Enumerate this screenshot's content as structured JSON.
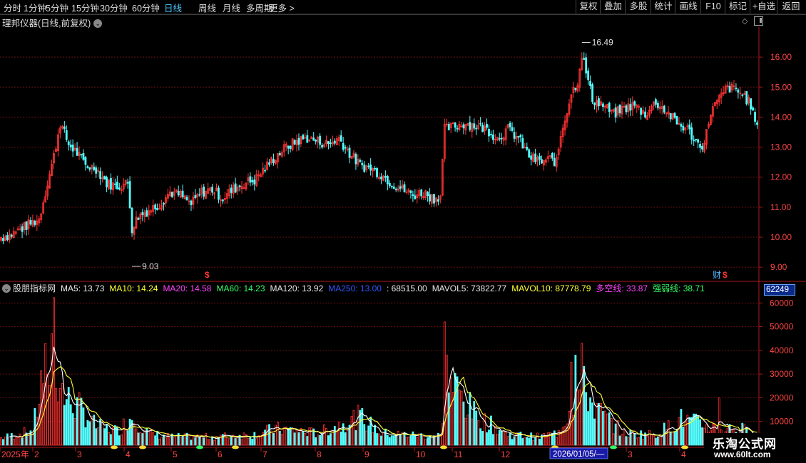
{
  "periods": [
    "分时",
    "1分钟",
    "5分钟",
    "15分钟",
    "30分钟",
    "60分钟",
    "日线",
    "周线",
    "月线",
    "多周期",
    "更多"
  ],
  "active_period": "日线",
  "toolbar": [
    "复权",
    "叠加",
    "多股",
    "统计",
    "画线",
    "F10",
    "标记",
    "+自选",
    "返回"
  ],
  "title": "理邦仪器(日线,前复权)",
  "indicator": {
    "name": "股朋指标网",
    "items": [
      {
        "label": "MA5: 13.73",
        "color": "#e8e8e8"
      },
      {
        "label": "MA10: 14.24",
        "color": "#ffff33"
      },
      {
        "label": "MA20: 14.58",
        "color": "#ff44ff"
      },
      {
        "label": "MA60: 14.23",
        "color": "#33ff66"
      },
      {
        "label": "MA120: 13.92",
        "color": "#e8e8e8"
      },
      {
        "label": "MA250: 13.00",
        "color": "#3355ff"
      },
      {
        "label": ": 68515.00",
        "color": "#e8e8e8"
      },
      {
        "label": "MAVOL5: 73822.77",
        "color": "#e8e8e8"
      },
      {
        "label": "MAVOL10: 87778.79",
        "color": "#ffff33"
      },
      {
        "label": "多空线: 33.87",
        "color": "#ff44ff"
      },
      {
        "label": "强弱线: 38.71",
        "color": "#33ff66"
      }
    ]
  },
  "current_volume": "62249",
  "price_max_label": "16.49",
  "price_min_label": "9.03",
  "fin_markers": {
    "dollar": "$",
    "fin": "财"
  },
  "x_cursor_label": "2026/01/05/—",
  "logo": {
    "title": "乐淘公式网",
    "url": "www.60lt.com"
  },
  "colors": {
    "up": "#ff3333",
    "down": "#54ffff",
    "grid": "#6a1010",
    "axis": "#b01818",
    "text": "#ff4444"
  },
  "chart_data": {
    "type": "candlestick",
    "price_axis": {
      "ticks": [
        9.0,
        10.0,
        11.0,
        12.0,
        13.0,
        14.0,
        15.0,
        16.0
      ],
      "labels": [
        "9.00",
        "10.00",
        "11.00",
        "12.00",
        "13.00",
        "14.00",
        "15.00",
        "16.00"
      ],
      "range": [
        8.6,
        17.0
      ]
    },
    "volume_axis": {
      "ticks": [
        10000,
        20000,
        30000,
        40000,
        50000,
        60000
      ],
      "labels": [
        "10000",
        "20000",
        "30000",
        "40000",
        "50000",
        "60000"
      ],
      "range": [
        0,
        64000
      ]
    },
    "x_labels": [
      "2025年",
      "2",
      "3",
      "4",
      "5",
      "6",
      "7",
      "8",
      "9",
      "10",
      "11",
      "12",
      "2026/01/05/—",
      "3",
      "4"
    ],
    "close_anchors": [
      [
        0,
        10.0
      ],
      [
        5,
        10.1
      ],
      [
        10,
        10.3
      ],
      [
        15,
        10.5
      ],
      [
        18,
        10.6
      ],
      [
        22,
        11.8
      ],
      [
        25,
        12.7
      ],
      [
        28,
        13.8
      ],
      [
        32,
        13.1
      ],
      [
        36,
        12.8
      ],
      [
        40,
        12.4
      ],
      [
        45,
        12.3
      ],
      [
        50,
        11.8
      ],
      [
        55,
        11.7
      ],
      [
        60,
        11.8
      ],
      [
        62,
        10.3
      ],
      [
        65,
        10.7
      ],
      [
        70,
        10.9
      ],
      [
        75,
        11.1
      ],
      [
        80,
        11.5
      ],
      [
        85,
        11.4
      ],
      [
        90,
        11.1
      ],
      [
        95,
        11.5
      ],
      [
        100,
        11.6
      ],
      [
        105,
        11.3
      ],
      [
        110,
        11.6
      ],
      [
        115,
        11.8
      ],
      [
        120,
        11.9
      ],
      [
        125,
        12.3
      ],
      [
        130,
        12.7
      ],
      [
        135,
        13.0
      ],
      [
        140,
        13.2
      ],
      [
        145,
        13.3
      ],
      [
        150,
        13.2
      ],
      [
        155,
        13.1
      ],
      [
        160,
        13.3
      ],
      [
        165,
        12.8
      ],
      [
        170,
        12.4
      ],
      [
        175,
        12.3
      ],
      [
        180,
        12.1
      ],
      [
        185,
        11.8
      ],
      [
        190,
        11.6
      ],
      [
        195,
        11.4
      ],
      [
        200,
        11.5
      ],
      [
        205,
        11.3
      ],
      [
        208,
        11.4
      ],
      [
        210,
        13.6
      ],
      [
        215,
        13.7
      ],
      [
        220,
        13.8
      ],
      [
        225,
        13.7
      ],
      [
        230,
        13.6
      ],
      [
        235,
        13.3
      ],
      [
        240,
        13.6
      ],
      [
        245,
        13.3
      ],
      [
        250,
        12.7
      ],
      [
        255,
        12.5
      ],
      [
        260,
        12.6
      ],
      [
        263,
        12.5
      ],
      [
        265,
        13.4
      ],
      [
        270,
        14.8
      ],
      [
        273,
        15.2
      ],
      [
        275,
        16.1
      ],
      [
        280,
        14.6
      ],
      [
        285,
        14.4
      ],
      [
        290,
        14.1
      ],
      [
        295,
        14.3
      ],
      [
        300,
        14.4
      ],
      [
        305,
        14.1
      ],
      [
        310,
        14.5
      ],
      [
        315,
        14.2
      ],
      [
        320,
        13.8
      ],
      [
        325,
        13.6
      ],
      [
        330,
        13.1
      ],
      [
        333,
        13.1
      ],
      [
        336,
        14.2
      ],
      [
        340,
        14.6
      ],
      [
        344,
        15.0
      ],
      [
        348,
        14.9
      ],
      [
        352,
        14.7
      ],
      [
        355,
        14.4
      ],
      [
        358,
        13.6
      ]
    ],
    "volume_anchors": [
      [
        0,
        3000
      ],
      [
        15,
        6000
      ],
      [
        20,
        30000
      ],
      [
        25,
        35000
      ],
      [
        30,
        20000
      ],
      [
        38,
        15000
      ],
      [
        45,
        8000
      ],
      [
        55,
        6000
      ],
      [
        62,
        12000
      ],
      [
        70,
        5000
      ],
      [
        80,
        3500
      ],
      [
        100,
        3500
      ],
      [
        120,
        4500
      ],
      [
        130,
        7000
      ],
      [
        150,
        5000
      ],
      [
        170,
        12000
      ],
      [
        180,
        5000
      ],
      [
        200,
        4000
      ],
      [
        208,
        4000
      ],
      [
        210,
        25000
      ],
      [
        215,
        24000
      ],
      [
        225,
        12000
      ],
      [
        240,
        4500
      ],
      [
        255,
        3500
      ],
      [
        263,
        5000
      ],
      [
        270,
        16000
      ],
      [
        275,
        25000
      ],
      [
        283,
        14000
      ],
      [
        295,
        5000
      ],
      [
        310,
        4500
      ],
      [
        322,
        11000
      ],
      [
        330,
        9000
      ],
      [
        340,
        7000
      ],
      [
        350,
        7000
      ],
      [
        358,
        4000
      ]
    ],
    "spikes": [
      [
        25,
        62249
      ],
      [
        210,
        52000
      ],
      [
        275,
        43000
      ],
      [
        270,
        35000
      ],
      [
        24,
        47000
      ],
      [
        272,
        38000
      ],
      [
        22,
        30000
      ],
      [
        211,
        38000
      ],
      [
        340,
        20000
      ]
    ],
    "ma_lines": [
      {
        "name": "MAVOL5",
        "color": "#ffffff"
      },
      {
        "name": "MAVOL10",
        "color": "#ffff33"
      }
    ]
  }
}
